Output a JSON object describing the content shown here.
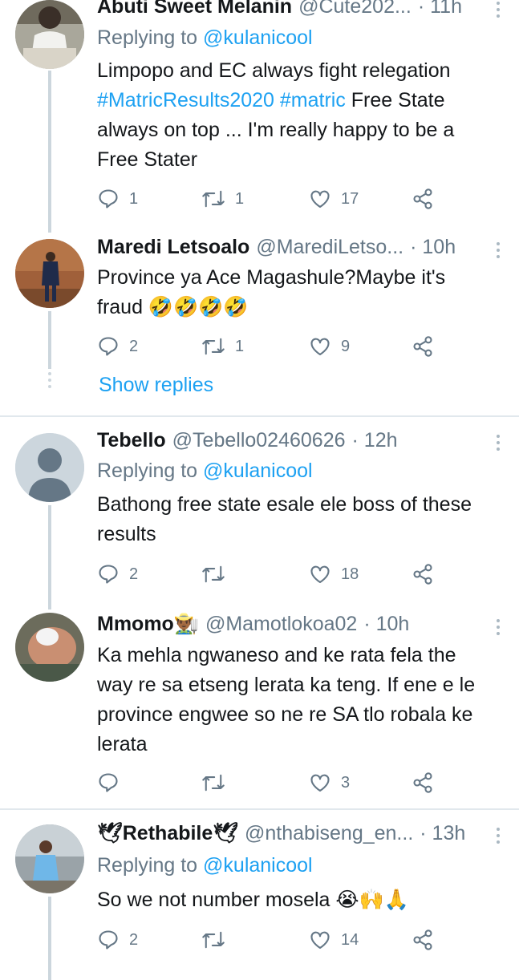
{
  "tweets": [
    {
      "name": "Abuti Sweet Melanin",
      "handle": "@Cute202...",
      "time": "· 11h",
      "replying_prefix": "Replying to ",
      "replying_to": "@kulanicool",
      "text_lines": [
        "Limpopo and EC always fight relegation"
      ],
      "hashtags": "#MatricResults2020 #matric",
      "text_after_hashtags": " Free State",
      "text_rest": [
        "always on top ... I'm really happy to be a",
        "Free Stater"
      ],
      "replies": "1",
      "retweets": "1",
      "likes": "17"
    },
    {
      "name": "Maredi Letsoalo",
      "handle": "@MarediLetso...",
      "time": "· 10h",
      "text_lines": [
        "Province ya Ace Magashule?Maybe it's",
        "fraud 🤣🤣🤣🤣"
      ],
      "replies": "2",
      "retweets": "1",
      "likes": "9",
      "show_replies": "Show replies"
    },
    {
      "name": "Tebello",
      "handle": "@Tebello02460626",
      "time": "· 12h",
      "replying_prefix": "Replying to ",
      "replying_to": "@kulanicool",
      "text_lines": [
        "Bathong free state esale ele boss of these",
        "results"
      ],
      "replies": "2",
      "retweets": "",
      "likes": "18"
    },
    {
      "name": "Mmomo👨🏾‍🌾",
      "handle": "@Mamotlokoa02",
      "time": "· 10h",
      "text_lines": [
        "Ka mehla ngwaneso and ke rata fela the",
        "way re sa etseng lerata ka teng. If ene e le",
        "province engwee so ne re SA tlo robala ke",
        "lerata"
      ],
      "replies": "",
      "retweets": "",
      "likes": "3"
    },
    {
      "name": "🕊Rethabile🕊",
      "handle": "@nthabiseng_en...",
      "time": "· 13h",
      "replying_prefix": "Replying to ",
      "replying_to": "@kulanicool",
      "text_lines": [
        "So we not number mosela 😭🙌🙏"
      ],
      "replies": "2",
      "retweets": "",
      "likes": "14"
    }
  ],
  "icons": {
    "reply": "reply-icon",
    "retweet": "retweet-icon",
    "like": "heart-icon",
    "share": "share-icon",
    "more": "more-vertical-icon"
  },
  "colors": {
    "accent": "#1da1f2",
    "secondary_text": "#657786",
    "divider": "#e1e8ed",
    "thread_line": "#ccd6dd"
  }
}
